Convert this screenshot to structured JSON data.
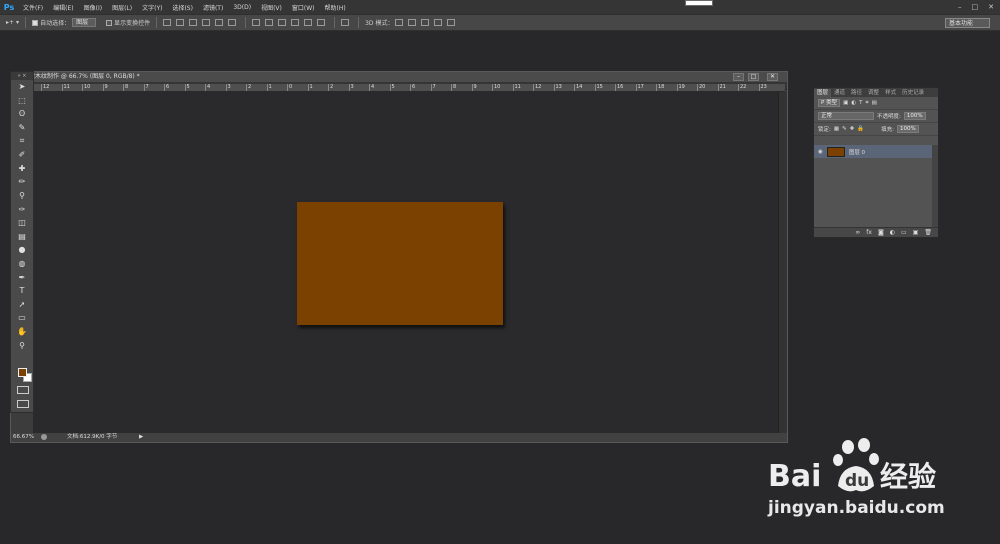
{
  "menubar": {
    "logo": "Ps",
    "items": [
      "文件(F)",
      "编辑(E)",
      "图像(I)",
      "图层(L)",
      "文字(Y)",
      "选择(S)",
      "滤镜(T)",
      "3D(D)",
      "视图(V)",
      "窗口(W)",
      "帮助(H)"
    ],
    "win_minimize": "–",
    "win_restore": "□",
    "win_close": "✕"
  },
  "options": {
    "tool_icon": "▸+",
    "auto_select_label": "自动选择：",
    "auto_select_value": "图层",
    "show_transform_label": "显示变换控件",
    "mode_3d_label": "3D 模式：",
    "workspace": "基本功能"
  },
  "document": {
    "title": "做木纹制作 @ 66.7% (图层 0, RGB/8) *",
    "zoom": "66.67%",
    "doc_info": "文档:612.9K/0 字节",
    "ruler_labels": [
      "12",
      "11",
      "10",
      "9",
      "8",
      "7",
      "6",
      "5",
      "4",
      "3",
      "2",
      "1",
      "0",
      "1",
      "2",
      "3",
      "4",
      "5",
      "6",
      "7",
      "8",
      "9",
      "10",
      "11",
      "12",
      "13",
      "14",
      "15",
      "16",
      "17",
      "18",
      "19",
      "20",
      "21",
      "22",
      "23"
    ],
    "artboard_color": "#7a4101"
  },
  "tools": {
    "header": "» ×",
    "icons": [
      "move-icon",
      "marquee-icon",
      "lasso-icon",
      "quick-select-icon",
      "crop-icon",
      "eyedropper-icon",
      "healing-icon",
      "brush-icon",
      "stamp-icon",
      "history-brush-icon",
      "eraser-icon",
      "gradient-icon",
      "blur-icon",
      "dodge-icon",
      "pen-icon",
      "type-icon",
      "path-select-icon",
      "shape-icon",
      "hand-icon",
      "zoom-icon"
    ],
    "glyphs": [
      "➤",
      "⬚",
      "ʘ",
      "✎",
      "⌗",
      "✐",
      "✚",
      "✏",
      "⚲",
      "✑",
      "◫",
      "▤",
      "●",
      "◍",
      "✒",
      "T",
      "➚",
      "▭",
      "✋",
      "⚲"
    ],
    "foreground_color": "#7a4101",
    "background_color": "#ffffff"
  },
  "layers": {
    "tabs": [
      "图层",
      "通道",
      "路径",
      "调整",
      "样式",
      "历史记录"
    ],
    "filter_kind": "P 类型",
    "blend_mode": "正常",
    "opacity_label": "不透明度:",
    "opacity_value": "100%",
    "lock_label": "锁定:",
    "fill_label": "填充:",
    "fill_value": "100%",
    "layer_name": "图层 0",
    "footer_icons": [
      "∞",
      "fx",
      "◙",
      "◐",
      "▭",
      "▣",
      "🗑"
    ]
  },
  "watermark": {
    "brand": "Bai",
    "brand2": "du",
    "suffix": "经验",
    "url": "jingyan.baidu.com"
  }
}
